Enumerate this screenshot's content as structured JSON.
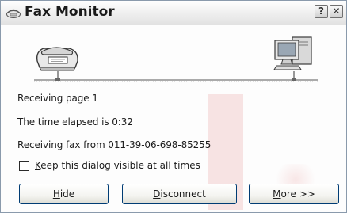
{
  "window": {
    "title": "Fax Monitor",
    "help_label": "?",
    "close_label": "✕"
  },
  "icons": {
    "title": "fax-monitor-icon",
    "fax": "fax-machine-icon",
    "computer": "computer-icon"
  },
  "status": {
    "page_line": "Receiving page 1",
    "elapsed_line": "The time elapsed is 0:32",
    "from_line": "Receiving fax from 011-39-06-698-85255"
  },
  "checkbox": {
    "mnemonic": "K",
    "label_rest": "eep this dialog visible at all times",
    "checked": false
  },
  "buttons": {
    "hide": {
      "mnemonic": "H",
      "rest": "ide"
    },
    "disconnect": {
      "mnemonic": "D",
      "rest": "isconnect"
    },
    "more": {
      "mnemonic": "M",
      "rest": "ore >>"
    }
  },
  "colors": {
    "button_border": "#003c74",
    "watermark": "#f6dede"
  }
}
